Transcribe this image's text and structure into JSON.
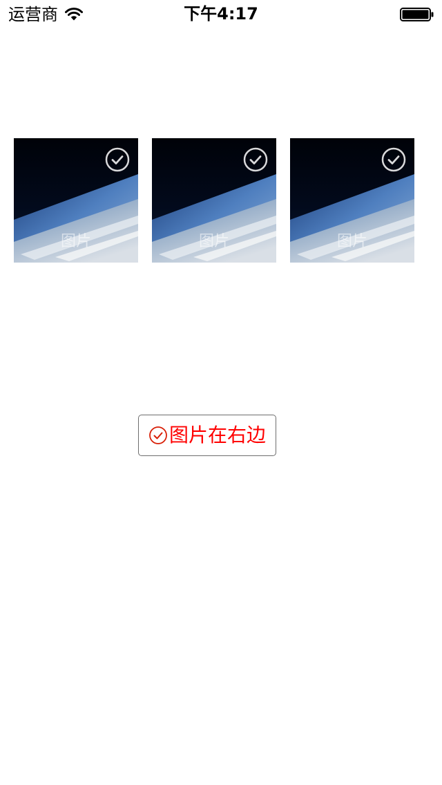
{
  "status_bar": {
    "carrier": "运营商",
    "time": "下午4:17",
    "wifi_icon": "wifi-icon",
    "battery_icon": "battery-full-icon"
  },
  "thumbnails": [
    {
      "label": "图片",
      "check_icon": "check-circle-icon"
    },
    {
      "label": "图片",
      "check_icon": "check-circle-icon"
    },
    {
      "label": "图片",
      "check_icon": "check-circle-icon"
    }
  ],
  "button": {
    "label": "图片在右边",
    "icon": "check-circle-icon"
  },
  "colors": {
    "button_text": "#ff0000",
    "button_icon": "#d81e06",
    "button_border": "#6d6d6d",
    "check_overlay": "#ffffff"
  }
}
